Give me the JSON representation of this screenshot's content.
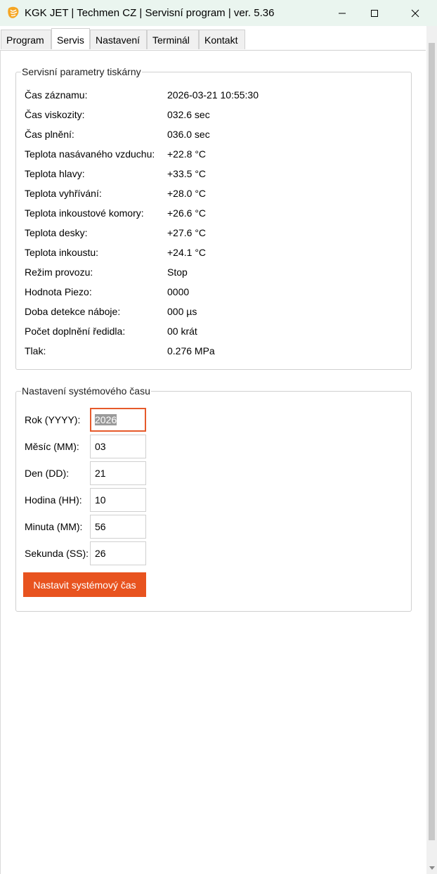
{
  "window": {
    "title": "KGK JET | Techmen CZ | Servisní program | ver. 5.36",
    "icon": "app-logo-icon",
    "accent": "#e8531f"
  },
  "tabs": [
    {
      "label": "Program",
      "active": false
    },
    {
      "label": "Servis",
      "active": true
    },
    {
      "label": "Nastavení",
      "active": false
    },
    {
      "label": "Terminál",
      "active": false
    },
    {
      "label": "Kontakt",
      "active": false
    }
  ],
  "service_params": {
    "title": "Servisní parametry tiskárny",
    "rows": [
      {
        "label": "Čas záznamu:",
        "value": "2026-03-21 10:55:30"
      },
      {
        "label": "Čas viskozity:",
        "value": "032.6 sec"
      },
      {
        "label": "Čas plnění:",
        "value": "036.0 sec"
      },
      {
        "label": "Teplota nasávaného vzduchu:",
        "value": "+22.8 °C"
      },
      {
        "label": "Teplota hlavy:",
        "value": "+33.5 °C"
      },
      {
        "label": "Teplota vyhřívání:",
        "value": "+28.0 °C"
      },
      {
        "label": "Teplota inkoustové komory:",
        "value": "+26.6 °C"
      },
      {
        "label": "Teplota desky:",
        "value": "+27.6 °C"
      },
      {
        "label": "Teplota inkoustu:",
        "value": "+24.1 °C"
      },
      {
        "label": "Režim provozu:",
        "value": "Stop"
      },
      {
        "label": "Hodnota Piezo:",
        "value": "0000"
      },
      {
        "label": "Doba detekce náboje:",
        "value": "000 µs"
      },
      {
        "label": "Počet doplnění ředidla:",
        "value": "00 krát"
      },
      {
        "label": "Tlak:",
        "value": "0.276 MPa"
      }
    ]
  },
  "system_time": {
    "title": "Nastavení systémového času",
    "fields": [
      {
        "label": "Rok (YYYY):",
        "value": "2026",
        "focused": true
      },
      {
        "label": "Měsíc (MM):",
        "value": "03",
        "focused": false
      },
      {
        "label": "Den (DD):",
        "value": "21",
        "focused": false
      },
      {
        "label": "Hodina (HH):",
        "value": "10",
        "focused": false
      },
      {
        "label": "Minuta (MM):",
        "value": "56",
        "focused": false
      },
      {
        "label": "Sekunda (SS):",
        "value": "26",
        "focused": false
      }
    ],
    "button_label": "Nastavit systémový čas"
  }
}
